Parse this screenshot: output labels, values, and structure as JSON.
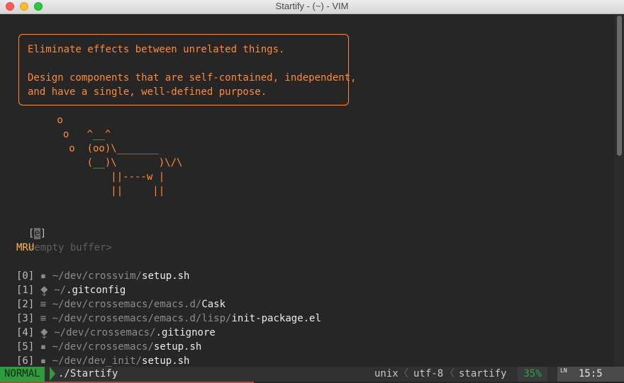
{
  "window": {
    "title": "Startify - (~) - VIM"
  },
  "quote": {
    "line1": "Eliminate effects between unrelated things.",
    "line2": "Design components that are self-contained, independent,",
    "line3": "and have a single, well-defined purpose."
  },
  "cow": " o\n  o   ^__^\n   o  (oo)\\_______\n      (__)\\       )\\/\\\n          ||----w |\n          ||     ||",
  "empty_buffer": {
    "key": "e",
    "label": "<empty buffer>"
  },
  "mru": {
    "heading": "MRU",
    "items": [
      {
        "index": "[0]",
        "icon": "file-icon",
        "dir": "~/dev/crossvim/",
        "file": "setup.sh"
      },
      {
        "index": "[1]",
        "icon": "git-icon",
        "dir": "~/",
        "file": ".gitconfig"
      },
      {
        "index": "[2]",
        "icon": "text-icon",
        "dir": "~/dev/crossemacs/emacs.d/",
        "file": "Cask"
      },
      {
        "index": "[3]",
        "icon": "text-icon",
        "dir": "~/dev/crossemacs/emacs.d/lisp/",
        "file": "init-package.el"
      },
      {
        "index": "[4]",
        "icon": "git-icon",
        "dir": "~/dev/crossemacs/",
        "file": ".gitignore"
      },
      {
        "index": "[5]",
        "icon": "file-icon",
        "dir": "~/dev/crossemacs/",
        "file": "setup.sh"
      },
      {
        "index": "[6]",
        "icon": "file-icon",
        "dir": "~/dev/dev_init/",
        "file": "setup.sh"
      }
    ]
  },
  "statusline": {
    "mode": "NORMAL",
    "buffer": "./Startify",
    "fileformat": "unix",
    "encoding": "utf-8",
    "filetype": "startify",
    "percent": "35%",
    "ln_label": "LN",
    "position": "15:5",
    "separator": "〈"
  },
  "colors": {
    "accent": "#ff8a35",
    "mode_bg": "#2e9c3d",
    "percent": "#2ea544"
  }
}
